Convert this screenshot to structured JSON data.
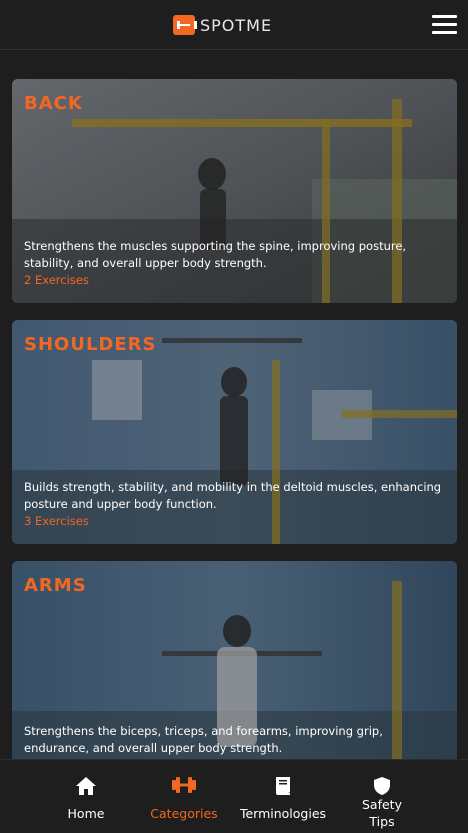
{
  "app": {
    "name": "SPOTME",
    "accent": "#f26722",
    "background": "#1e1e1e"
  },
  "header": {
    "menu_icon": "hamburger-menu-icon"
  },
  "categories": [
    {
      "title": "BACK",
      "description": "Strengthens the muscles supporting the spine, improving posture, stability, and overall upper body strength.",
      "count": "2 Exercises"
    },
    {
      "title": "SHOULDERS",
      "description": "Builds strength, stability, and mobility in the deltoid muscles, enhancing posture and upper body function.",
      "count": "3 Exercises"
    },
    {
      "title": "ARMS",
      "description": "Strengthens the biceps, triceps, and forearms, improving grip, endurance, and overall upper body strength."
    }
  ],
  "nav": {
    "items": [
      {
        "label": "Home",
        "icon": "home-icon"
      },
      {
        "label": "Categories",
        "icon": "dumbbell-icon",
        "active": true
      },
      {
        "label": "Terminologies",
        "icon": "book-icon"
      },
      {
        "label": "Safety Tips",
        "icon": "shield-icon"
      }
    ]
  }
}
